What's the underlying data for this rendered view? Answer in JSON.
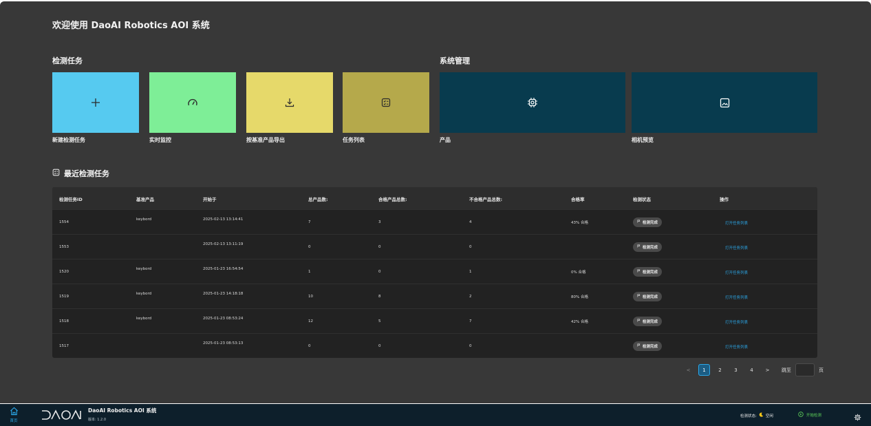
{
  "page": {
    "welcome": "欢迎使用 DaoAI Robotics AOI 系统"
  },
  "sections": {
    "detect_tasks": "检测任务",
    "system_mgmt": "系统管理"
  },
  "tiles": [
    {
      "label": "新建检测任务",
      "icon": "plus-icon",
      "color": "#56caf0"
    },
    {
      "label": "实时监控",
      "icon": "gauge-icon",
      "color": "#7eee97"
    },
    {
      "label": "按基准产品导出",
      "icon": "download-icon",
      "color": "#e6d96a"
    },
    {
      "label": "任务列表",
      "icon": "checklist-icon",
      "color": "#b5a94b"
    },
    {
      "label": "产品",
      "icon": "chip-icon",
      "color": "#083b4e"
    },
    {
      "label": "相机预览",
      "icon": "image-icon",
      "color": "#083b4e"
    }
  ],
  "recent": {
    "title": "最近检测任务",
    "columns": [
      "检测任务ID",
      "基准产品",
      "开始于",
      "总产品数:",
      "合格产品总数:",
      "不合格产品总数:",
      "合格率",
      "检测状态",
      "操作"
    ],
    "rows": [
      {
        "id": "1554",
        "product": "keybord",
        "start": "2025-02-13 13:14:41",
        "total": "7",
        "pass": "3",
        "fail": "4",
        "rate": "43% 合格",
        "status": "检测完成",
        "action": "打开任务列表"
      },
      {
        "id": "1553",
        "product": "",
        "start": "2025-02-13 13:11:19",
        "total": "0",
        "pass": "0",
        "fail": "0",
        "rate": "",
        "status": "检测完成",
        "action": "打开任务列表"
      },
      {
        "id": "1520",
        "product": "keybord",
        "start": "2025-01-23 16:54:54",
        "total": "1",
        "pass": "0",
        "fail": "1",
        "rate": "0% 合格",
        "status": "检测完成",
        "action": "打开任务列表"
      },
      {
        "id": "1519",
        "product": "keybord",
        "start": "2025-01-23 14:18:18",
        "total": "10",
        "pass": "8",
        "fail": "2",
        "rate": "80% 合格",
        "status": "检测完成",
        "action": "打开任务列表"
      },
      {
        "id": "1518",
        "product": "keybord",
        "start": "2025-01-23 08:53:24",
        "total": "12",
        "pass": "5",
        "fail": "7",
        "rate": "42% 合格",
        "status": "检测完成",
        "action": "打开任务列表"
      },
      {
        "id": "1517",
        "product": "",
        "start": "2025-01-23 08:53:13",
        "total": "0",
        "pass": "0",
        "fail": "0",
        "rate": "",
        "status": "检测完成",
        "action": "打开任务列表"
      }
    ]
  },
  "pagination": {
    "prev": "<",
    "pages": [
      "1",
      "2",
      "3",
      "4"
    ],
    "current": "1",
    "next": ">",
    "jump_label": "跳至",
    "page_suffix": "页"
  },
  "footer": {
    "home_label": "首页",
    "logo_text": "DAOAI",
    "app_name": "DaoAI Robotics AOI 系统",
    "version": "版本: 1.2.0",
    "detect_status_label": "检测状态:",
    "detect_status_value": "空闲",
    "start_label": "开始检测"
  },
  "colors": {
    "accent": "#2ba7e8",
    "start_green": "#5fd35a",
    "footer_bg": "#0d1f2b"
  }
}
